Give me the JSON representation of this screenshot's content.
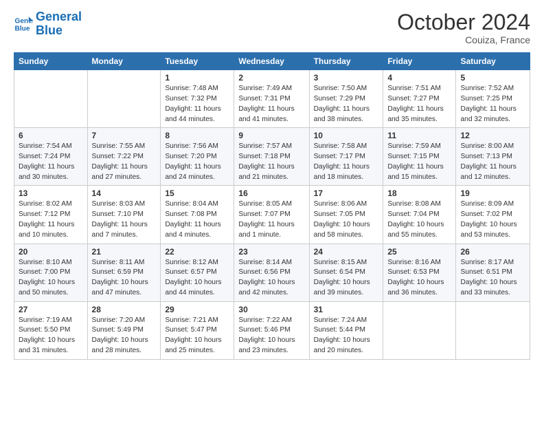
{
  "header": {
    "logo_line1": "General",
    "logo_line2": "Blue",
    "month": "October 2024",
    "location": "Couiza, France"
  },
  "days_of_week": [
    "Sunday",
    "Monday",
    "Tuesday",
    "Wednesday",
    "Thursday",
    "Friday",
    "Saturday"
  ],
  "weeks": [
    [
      {
        "day": "",
        "info": ""
      },
      {
        "day": "",
        "info": ""
      },
      {
        "day": "1",
        "info": "Sunrise: 7:48 AM\nSunset: 7:32 PM\nDaylight: 11 hours and 44 minutes."
      },
      {
        "day": "2",
        "info": "Sunrise: 7:49 AM\nSunset: 7:31 PM\nDaylight: 11 hours and 41 minutes."
      },
      {
        "day": "3",
        "info": "Sunrise: 7:50 AM\nSunset: 7:29 PM\nDaylight: 11 hours and 38 minutes."
      },
      {
        "day": "4",
        "info": "Sunrise: 7:51 AM\nSunset: 7:27 PM\nDaylight: 11 hours and 35 minutes."
      },
      {
        "day": "5",
        "info": "Sunrise: 7:52 AM\nSunset: 7:25 PM\nDaylight: 11 hours and 32 minutes."
      }
    ],
    [
      {
        "day": "6",
        "info": "Sunrise: 7:54 AM\nSunset: 7:24 PM\nDaylight: 11 hours and 30 minutes."
      },
      {
        "day": "7",
        "info": "Sunrise: 7:55 AM\nSunset: 7:22 PM\nDaylight: 11 hours and 27 minutes."
      },
      {
        "day": "8",
        "info": "Sunrise: 7:56 AM\nSunset: 7:20 PM\nDaylight: 11 hours and 24 minutes."
      },
      {
        "day": "9",
        "info": "Sunrise: 7:57 AM\nSunset: 7:18 PM\nDaylight: 11 hours and 21 minutes."
      },
      {
        "day": "10",
        "info": "Sunrise: 7:58 AM\nSunset: 7:17 PM\nDaylight: 11 hours and 18 minutes."
      },
      {
        "day": "11",
        "info": "Sunrise: 7:59 AM\nSunset: 7:15 PM\nDaylight: 11 hours and 15 minutes."
      },
      {
        "day": "12",
        "info": "Sunrise: 8:00 AM\nSunset: 7:13 PM\nDaylight: 11 hours and 12 minutes."
      }
    ],
    [
      {
        "day": "13",
        "info": "Sunrise: 8:02 AM\nSunset: 7:12 PM\nDaylight: 11 hours and 10 minutes."
      },
      {
        "day": "14",
        "info": "Sunrise: 8:03 AM\nSunset: 7:10 PM\nDaylight: 11 hours and 7 minutes."
      },
      {
        "day": "15",
        "info": "Sunrise: 8:04 AM\nSunset: 7:08 PM\nDaylight: 11 hours and 4 minutes."
      },
      {
        "day": "16",
        "info": "Sunrise: 8:05 AM\nSunset: 7:07 PM\nDaylight: 11 hours and 1 minute."
      },
      {
        "day": "17",
        "info": "Sunrise: 8:06 AM\nSunset: 7:05 PM\nDaylight: 10 hours and 58 minutes."
      },
      {
        "day": "18",
        "info": "Sunrise: 8:08 AM\nSunset: 7:04 PM\nDaylight: 10 hours and 55 minutes."
      },
      {
        "day": "19",
        "info": "Sunrise: 8:09 AM\nSunset: 7:02 PM\nDaylight: 10 hours and 53 minutes."
      }
    ],
    [
      {
        "day": "20",
        "info": "Sunrise: 8:10 AM\nSunset: 7:00 PM\nDaylight: 10 hours and 50 minutes."
      },
      {
        "day": "21",
        "info": "Sunrise: 8:11 AM\nSunset: 6:59 PM\nDaylight: 10 hours and 47 minutes."
      },
      {
        "day": "22",
        "info": "Sunrise: 8:12 AM\nSunset: 6:57 PM\nDaylight: 10 hours and 44 minutes."
      },
      {
        "day": "23",
        "info": "Sunrise: 8:14 AM\nSunset: 6:56 PM\nDaylight: 10 hours and 42 minutes."
      },
      {
        "day": "24",
        "info": "Sunrise: 8:15 AM\nSunset: 6:54 PM\nDaylight: 10 hours and 39 minutes."
      },
      {
        "day": "25",
        "info": "Sunrise: 8:16 AM\nSunset: 6:53 PM\nDaylight: 10 hours and 36 minutes."
      },
      {
        "day": "26",
        "info": "Sunrise: 8:17 AM\nSunset: 6:51 PM\nDaylight: 10 hours and 33 minutes."
      }
    ],
    [
      {
        "day": "27",
        "info": "Sunrise: 7:19 AM\nSunset: 5:50 PM\nDaylight: 10 hours and 31 minutes."
      },
      {
        "day": "28",
        "info": "Sunrise: 7:20 AM\nSunset: 5:49 PM\nDaylight: 10 hours and 28 minutes."
      },
      {
        "day": "29",
        "info": "Sunrise: 7:21 AM\nSunset: 5:47 PM\nDaylight: 10 hours and 25 minutes."
      },
      {
        "day": "30",
        "info": "Sunrise: 7:22 AM\nSunset: 5:46 PM\nDaylight: 10 hours and 23 minutes."
      },
      {
        "day": "31",
        "info": "Sunrise: 7:24 AM\nSunset: 5:44 PM\nDaylight: 10 hours and 20 minutes."
      },
      {
        "day": "",
        "info": ""
      },
      {
        "day": "",
        "info": ""
      }
    ]
  ]
}
